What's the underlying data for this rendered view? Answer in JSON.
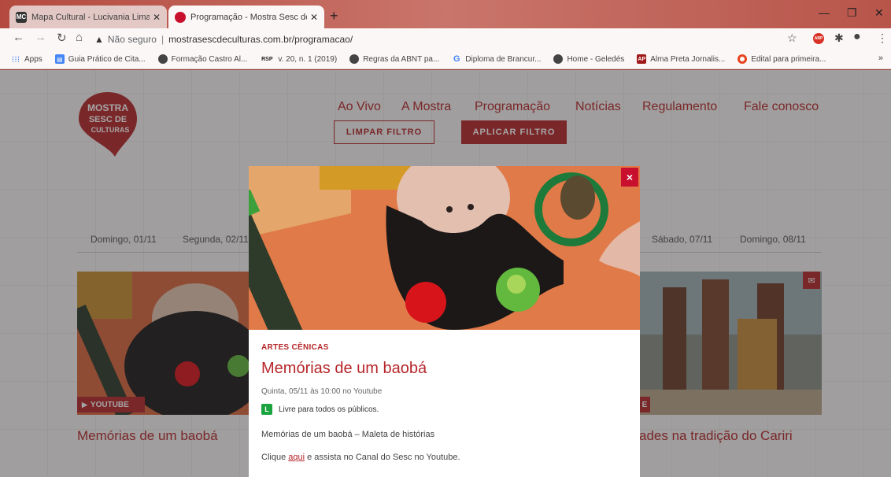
{
  "browser": {
    "tabs": [
      {
        "favicon": "MC",
        "title": "Mapa Cultural - Lucivania Lima - ",
        "active": false
      },
      {
        "favicon": "ms",
        "title": "Programação - Mostra Sesc de C",
        "active": true
      }
    ],
    "security_label": "Não seguro",
    "url": "mostrasescdeculturas.com.br/programacao/",
    "bookmarks": [
      {
        "icon": "apps-grid-icon",
        "label": "Apps"
      },
      {
        "icon": "book-icon",
        "label": "Guia Prático de Cita..."
      },
      {
        "icon": "globe-icon",
        "label": "Formação Castro Al..."
      },
      {
        "icon": "rsp-icon",
        "label": "v. 20, n. 1 (2019)"
      },
      {
        "icon": "globe-icon",
        "label": "Regras da ABNT pa..."
      },
      {
        "icon": "google-icon",
        "label": "Diploma de Brancur..."
      },
      {
        "icon": "globe-icon",
        "label": "Home - Geledés"
      },
      {
        "icon": "ap-icon",
        "label": "Alma Preta Jornalis..."
      },
      {
        "icon": "red-circle-icon",
        "label": "Edital para primeira..."
      }
    ],
    "bookmarks_more": "»",
    "extension_badge": "ABP"
  },
  "site": {
    "logo_text": [
      "MOSTRA",
      "SESC DE",
      "CULTURAS"
    ],
    "nav": [
      "Ao Vivo",
      "A Mostra",
      "Programação",
      "Notícias",
      "Regulamento",
      "Fale conosco"
    ],
    "filter_clear": "LIMPAR FILTRO",
    "filter_apply": "APLICAR FILTRO",
    "days": [
      "Domingo, 01/11",
      "Segunda, 02/11",
      "Sábado, 07/11",
      "Domingo, 08/11"
    ],
    "left_card": {
      "badge": "YOUTUBE",
      "title": "Memórias de um baobá"
    },
    "right_card": {
      "badge": "E",
      "title": "ades na tradição do Cariri"
    }
  },
  "modal": {
    "category": "ARTES CÊNICAS",
    "title": "Memórias de um baobá",
    "date": "Quinta, 05/11 às 10:00 no Youtube",
    "rating_symbol": "L",
    "rating": "Livre para todos os públicos.",
    "description": "Memórias de um baobá – Maleta de histórias",
    "cta_prefix": "Clique ",
    "cta_link": "aqui",
    "cta_suffix": " e assista no Canal do Sesc no Youtube.",
    "close": "×"
  },
  "colors": {
    "brand_red": "#b6262a",
    "rating_green": "#1aa33f"
  }
}
